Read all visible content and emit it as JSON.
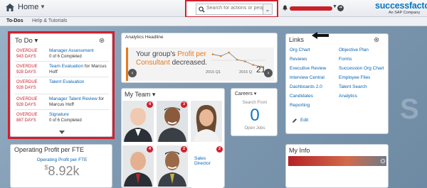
{
  "header": {
    "home_label": "Home",
    "search_placeholder": "Search for actions or people",
    "brand_name": "successfactors",
    "brand_sub": "An SAP Company",
    "colors": {
      "accent": "#0a76c0",
      "highlight": "#d0202d"
    }
  },
  "subnav": {
    "tabs": [
      {
        "label": "To-Dos",
        "active": true
      },
      {
        "label": "Help & Tutorials",
        "active": false
      }
    ]
  },
  "todo": {
    "title": "To Do",
    "items": [
      {
        "overdue": "OVERDUE",
        "days": "943 DAYS",
        "task": "Manager Assessment",
        "sub": "0 of 6 Completed"
      },
      {
        "overdue": "OVERDUE",
        "days": "928 DAYS",
        "task": "Team Evaluation",
        "for": " for Marcus Hoff"
      },
      {
        "overdue": "OVERDUE",
        "days": "928 DAYS",
        "task": "Talent Evaluation",
        "sub": ""
      },
      {
        "overdue": "OVERDUE",
        "days": "928 DAYS",
        "task": "Manager Talent Review",
        "for": " for Marcus Hoff"
      },
      {
        "overdue": "OVERDUE",
        "days": "887 DAYS",
        "task": "Signature",
        "sub": "0 of 6 Completed"
      }
    ]
  },
  "analytics": {
    "title": "Analytics Headline",
    "text_pre": "Your group's ",
    "text_highlight": "Profit per Consultant",
    "text_post": " decreased.",
    "value": "21",
    "x_label_1": "2015 Q1",
    "x_label_2": "2016 Q",
    "chart_data": {
      "type": "line",
      "series": [
        {
          "values": [
            28,
            27,
            29,
            25,
            24,
            22,
            21
          ]
        }
      ]
    }
  },
  "team": {
    "title": "My Team",
    "members": [
      {
        "badge": "4"
      },
      {
        "badge": "3"
      },
      {
        "badge": ""
      },
      {
        "badge": "4"
      },
      {
        "badge": "2"
      }
    ],
    "extra_label": "Sales Director",
    "extra_badge": "2"
  },
  "careers": {
    "title": "Careers",
    "search_label": "Search From",
    "count": "0",
    "caption": "Open Jobs"
  },
  "profit": {
    "title": "Operating Profit per FTE",
    "sub": "Operating Profit per FTE",
    "currency": "$",
    "value": "8.92k"
  },
  "links": {
    "title": "Links",
    "left": [
      "Org Chart",
      "Reviews",
      "Executive Review",
      "Interview Central",
      "Dashboards 2.0",
      "Candidates",
      "Reporting"
    ],
    "right": [
      "Objective Plan",
      "Forms",
      "Succession Org Chart",
      "Employee Files",
      "Talent Search",
      "Analytics"
    ],
    "edit_label": "Edit"
  },
  "info": {
    "title": "My Info"
  }
}
